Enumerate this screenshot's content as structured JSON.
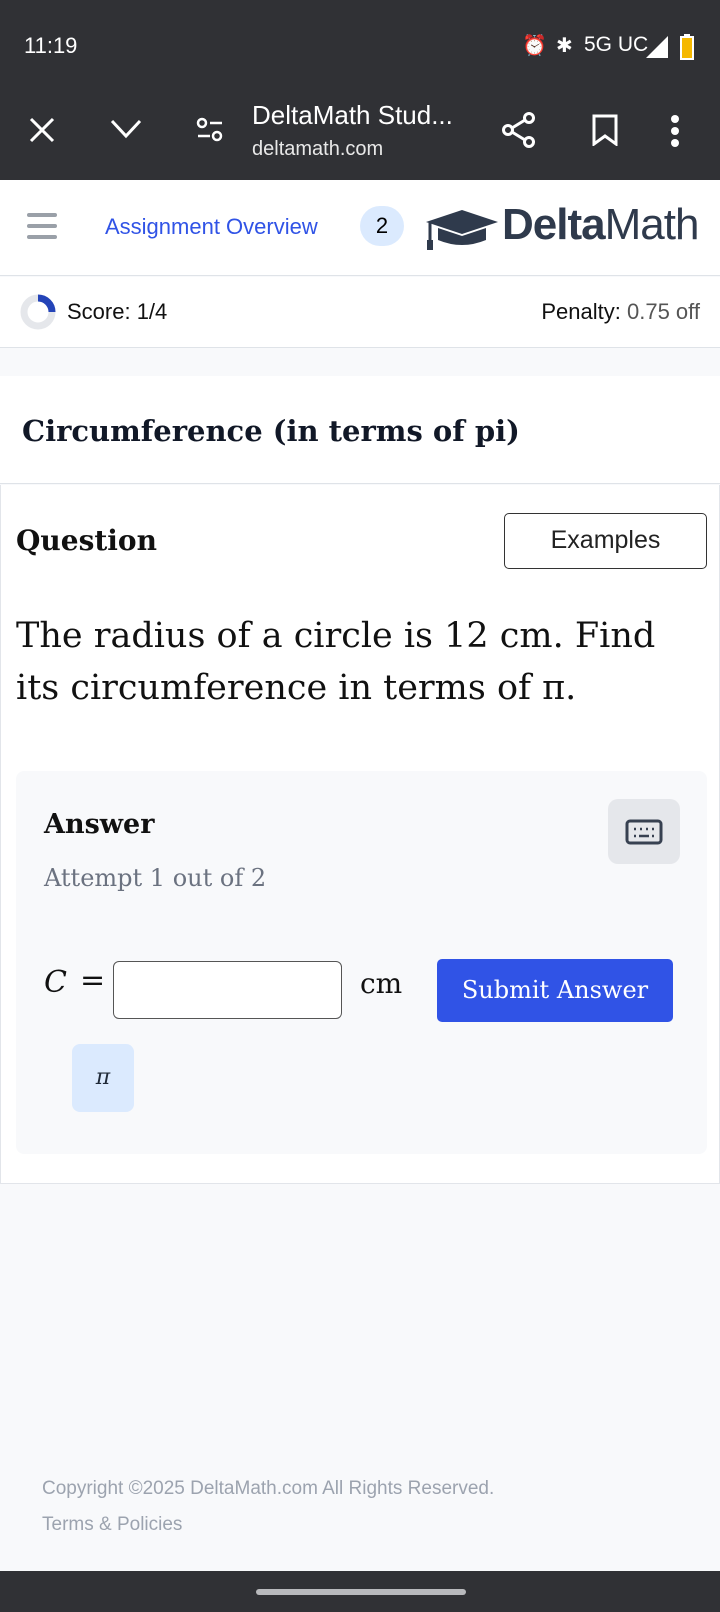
{
  "status_bar": {
    "time": "11:19",
    "network": "5G UC"
  },
  "browser": {
    "title": "DeltaMath Stud...",
    "url": "deltamath.com"
  },
  "nav": {
    "assignment_overview": "Assignment Overview",
    "badge": "2",
    "brand_bold": "Delta",
    "brand_light": "Math"
  },
  "score": {
    "label": "Score: 1/4",
    "progress": 0.25,
    "penalty_label": "Penalty:",
    "penalty_value": "0.75 off"
  },
  "problem": {
    "title": "Circumference (in terms of pi)",
    "question_heading": "Question",
    "examples_label": "Examples",
    "question_text": "The radius of a circle is 12 cm. Find its circumference in terms of π."
  },
  "answer": {
    "heading": "Answer",
    "attempt": "Attempt 1 out of 2",
    "variable": "C",
    "equals": "=",
    "input_value": "",
    "unit": "cm",
    "submit_label": "Submit Answer",
    "pi_button": "π"
  },
  "footer": {
    "copyright": "Copyright ©2025 DeltaMath.com All Rights Reserved.",
    "terms": "Terms & Policies"
  },
  "colors": {
    "accent": "#3053e6",
    "dark_bar": "#303135",
    "brand": "#2f3a4c"
  }
}
